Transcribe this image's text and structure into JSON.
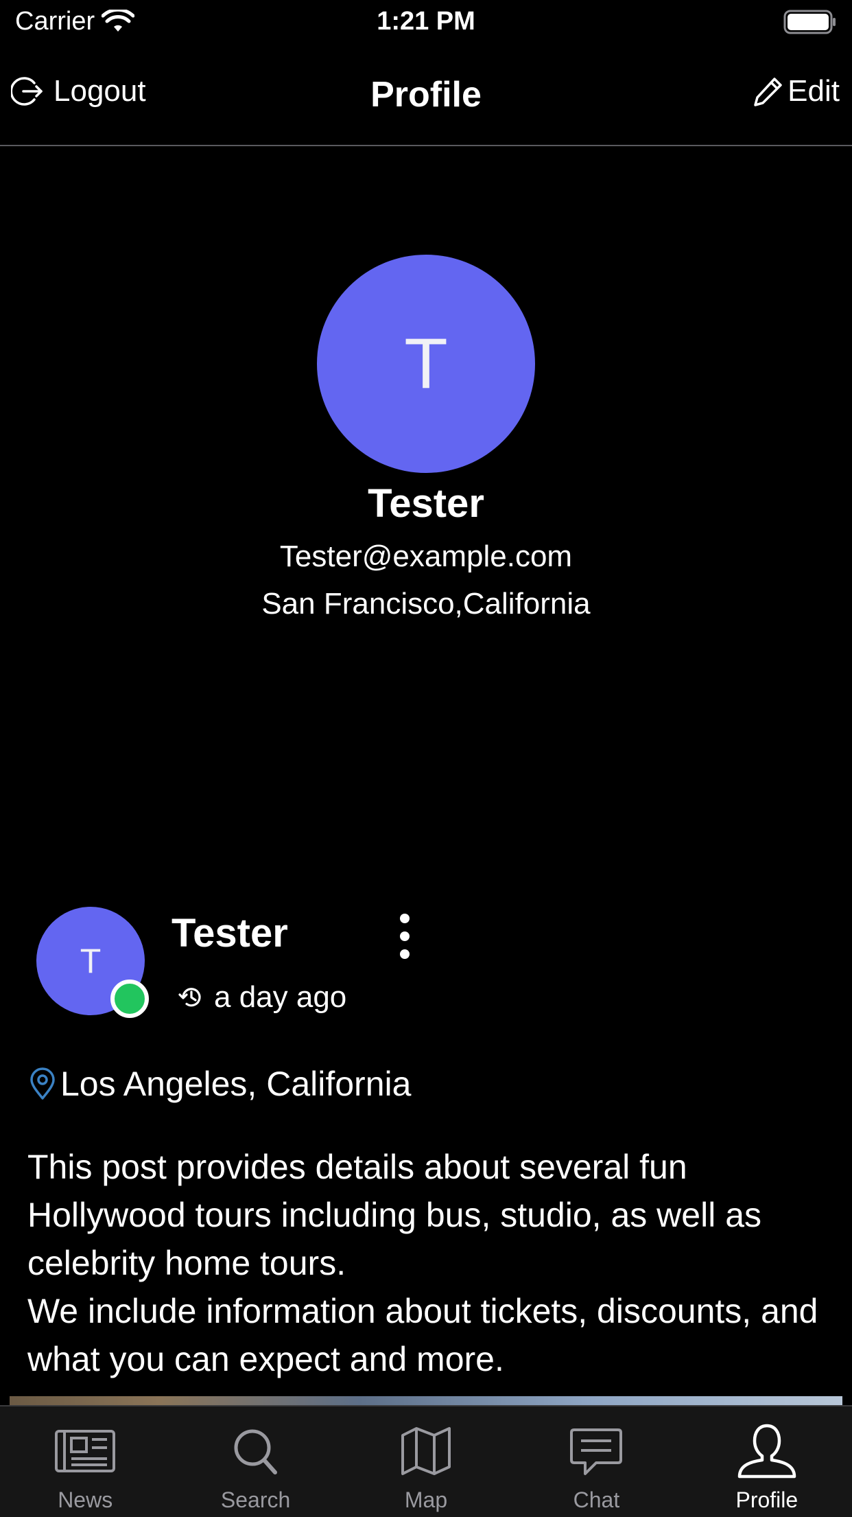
{
  "status_bar": {
    "carrier": "Carrier",
    "time": "1:21 PM"
  },
  "nav": {
    "logout_label": "Logout",
    "title": "Profile",
    "edit_label": "Edit"
  },
  "profile": {
    "avatar_initial": "T",
    "avatar_color": "#6366f1",
    "name": "Tester",
    "email": "Tester@example.com",
    "location": "San Francisco,California"
  },
  "post": {
    "avatar_initial": "T",
    "online_status_color": "#22c55e",
    "author": "Tester",
    "time_ago": "a day ago",
    "location": "Los Angeles, California",
    "location_icon_color": "#3b82c4",
    "body_lines": [
      "This post provides details about several fun Hollywood tours including bus, studio, as well as celebrity home tours.",
      "We include information about tickets, discounts, and what you can expect and more."
    ]
  },
  "tabs": [
    {
      "label": "News",
      "icon": "newspaper-icon",
      "active": false
    },
    {
      "label": "Search",
      "icon": "search-icon",
      "active": false
    },
    {
      "label": "Map",
      "icon": "map-icon",
      "active": false
    },
    {
      "label": "Chat",
      "icon": "chat-icon",
      "active": false
    },
    {
      "label": "Profile",
      "icon": "user-icon",
      "active": true
    }
  ]
}
